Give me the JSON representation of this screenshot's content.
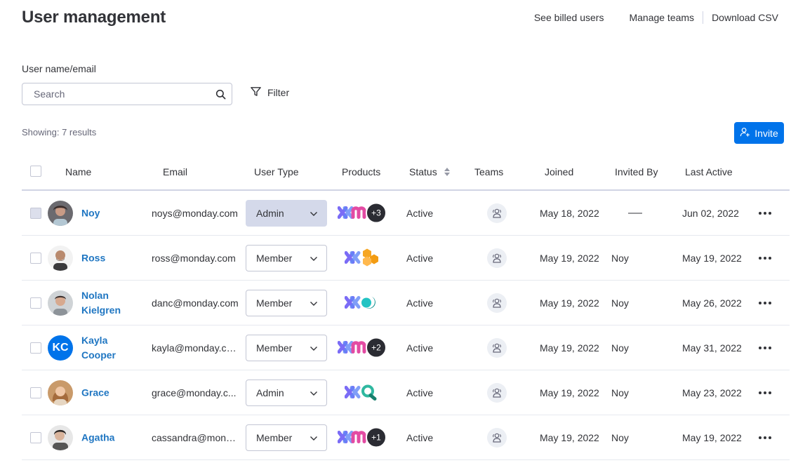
{
  "header": {
    "title": "User management",
    "links": [
      "See billed users",
      "Manage teams",
      "Download CSV"
    ]
  },
  "search": {
    "label": "User name/email",
    "placeholder": "Search"
  },
  "filter": {
    "label": "Filter"
  },
  "results": {
    "text": "Showing: 7 results"
  },
  "invite": {
    "label": "Invite"
  },
  "table": {
    "columns": [
      "Name",
      "Email",
      "User Type",
      "Products",
      "Status",
      "Teams",
      "Joined",
      "Invited By",
      "Last Active"
    ],
    "rows": [
      {
        "name": "Noy",
        "avatar": "photo-noy",
        "email": "noys@monday.com",
        "user_type": "Admin",
        "products_more": "+3",
        "status": "Active",
        "joined": "May 18, 2022",
        "invited_by": "",
        "last_active": "Jun 02, 2022"
      },
      {
        "name": "Ross",
        "avatar": "photo-ross",
        "email": "ross@monday.com",
        "user_type": "Member",
        "products_more": "",
        "status": "Active",
        "joined": "May 19, 2022",
        "invited_by": "Noy",
        "last_active": "May 19, 2022"
      },
      {
        "name": "Nolan Kielgren",
        "avatar": "photo-nolan",
        "email": "danc@monday.com",
        "user_type": "Member",
        "products_more": "",
        "status": "Active",
        "joined": "May 19, 2022",
        "invited_by": "Noy",
        "last_active": "May 26, 2022"
      },
      {
        "name": "Kayla Cooper",
        "avatar": "KC",
        "email": "kayla@monday.co...",
        "user_type": "Member",
        "products_more": "+2",
        "status": "Active",
        "joined": "May 19, 2022",
        "invited_by": "Noy",
        "last_active": "May 31, 2022"
      },
      {
        "name": "Grace",
        "avatar": "photo-grace",
        "email": "grace@monday.c...",
        "user_type": "Admin",
        "products_more": "",
        "status": "Active",
        "joined": "May 19, 2022",
        "invited_by": "Noy",
        "last_active": "May 23, 2022"
      },
      {
        "name": "Agatha",
        "avatar": "photo-agatha",
        "email": "cassandra@mond...",
        "user_type": "Member",
        "products_more": "+1",
        "status": "Active",
        "joined": "May 19, 2022",
        "invited_by": "Noy",
        "last_active": "May 19, 2022"
      }
    ]
  },
  "colors": {
    "accent": "#0073ea",
    "name_link": "#1f76c2",
    "text": "#323338",
    "muted": "#676879",
    "badge_dark": "#2b2c33"
  },
  "icons": {
    "search": "search-icon",
    "filter": "filter-icon",
    "invite": "add-user-icon",
    "sort": "sort-icon",
    "teams": "teams-icon",
    "more": "more-icon",
    "dropdown": "chevron-down-icon"
  }
}
